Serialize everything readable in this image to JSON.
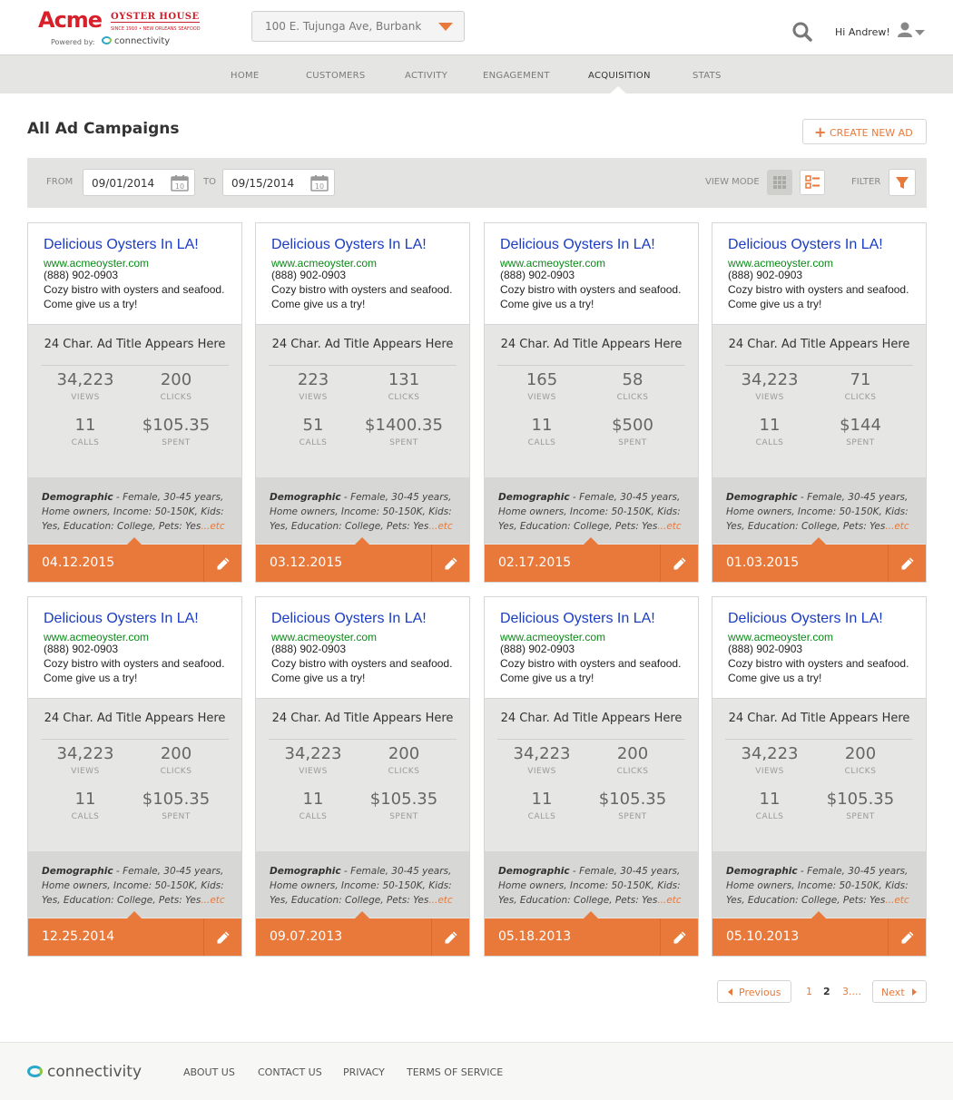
{
  "brand": {
    "name": "Acme",
    "sub": "OYSTER HOUSE",
    "tagline": "SINCE 1910 • NEW ORLEANS SEAFOOD",
    "powered_by": "Powered by:",
    "platform": "connectivity"
  },
  "header": {
    "location": "100 E. Tujunga Ave, Burbank",
    "greeting": "Hi Andrew!"
  },
  "nav": {
    "items": [
      "HOME",
      "CUSTOMERS",
      "ACTIVITY",
      "ENGAGEMENT",
      "ACQUISITION",
      "STATS"
    ],
    "active": "ACQUISITION"
  },
  "page": {
    "title": "All Ad Campaigns",
    "create_label": "CREATE NEW AD"
  },
  "filters": {
    "from_label": "FROM",
    "from_value": "09/01/2014",
    "to_label": "TO",
    "to_value": "09/15/2014",
    "view_mode_label": "VIEW MODE",
    "filter_label": "FILTER"
  },
  "ad": {
    "headline": "Delicious Oysters In LA!",
    "url": "www.acmeoyster.com",
    "phone": "(888) 902-0903",
    "description": "Cozy bistro with oysters and seafood. Come give us a try!",
    "title": "24 Char. Ad Title Appears Here",
    "demographic_label": "Demographic",
    "demographic_text": "Female, 30-45 years, Home owners, Income: 50-150K, Kids: Yes, Education: College, Pets: Yes",
    "demographic_more": "...etc"
  },
  "stat_labels": {
    "views": "VIEWS",
    "clicks": "CLICKS",
    "calls": "CALLS",
    "spent": "SPENT"
  },
  "campaigns": [
    {
      "views": "34,223",
      "clicks": "200",
      "calls": "11",
      "spent": "$105.35",
      "date": "04.12.2015"
    },
    {
      "views": "223",
      "clicks": "131",
      "calls": "51",
      "spent": "$1400.35",
      "date": "03.12.2015"
    },
    {
      "views": "165",
      "clicks": "58",
      "calls": "11",
      "spent": "$500",
      "date": "02.17.2015"
    },
    {
      "views": "34,223",
      "clicks": "71",
      "calls": "11",
      "spent": "$144",
      "date": "01.03.2015"
    },
    {
      "views": "34,223",
      "clicks": "200",
      "calls": "11",
      "spent": "$105.35",
      "date": "12.25.2014"
    },
    {
      "views": "34,223",
      "clicks": "200",
      "calls": "11",
      "spent": "$105.35",
      "date": "09.07.2013"
    },
    {
      "views": "34,223",
      "clicks": "200",
      "calls": "11",
      "spent": "$105.35",
      "date": "05.18.2013"
    },
    {
      "views": "34,223",
      "clicks": "200",
      "calls": "11",
      "spent": "$105.35",
      "date": "05.10.2013"
    }
  ],
  "pagination": {
    "previous": "Previous",
    "next": "Next",
    "pages": [
      "1",
      "2",
      "3...."
    ],
    "current": "2"
  },
  "footer": {
    "logo": "connectivity",
    "links": [
      "ABOUT US",
      "CONTACT US",
      "PRIVACY",
      "TERMS OF SERVICE"
    ]
  },
  "colors": {
    "accent": "#e8793a",
    "ad_headline": "#1a3cc2",
    "ad_url": "#0a8a17",
    "brand_red": "#d8202b"
  }
}
